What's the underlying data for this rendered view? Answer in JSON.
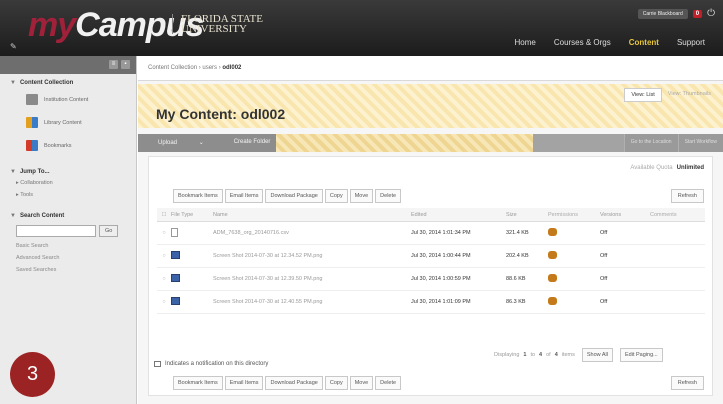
{
  "header": {
    "logo_my": "my",
    "logo_campus": "Campus",
    "university_line1": "FLORIDA STATE",
    "university_line2": "UNIVERSITY",
    "user_name": "Carrie Blackboard",
    "notification_count": "0",
    "nav": [
      "Home",
      "Courses & Orgs",
      "Content",
      "Support"
    ],
    "active_nav": "Content"
  },
  "sidebar": {
    "content_collection": "Content Collection",
    "collection_items": [
      "Institution Content",
      "Library Content",
      "Bookmarks"
    ],
    "jump_to": "Jump To...",
    "jump_items": [
      "Collaboration",
      "Tools"
    ],
    "search_content": "Search Content",
    "go_label": "Go",
    "search_links": [
      "Basic Search",
      "Advanced Search",
      "Saved Searches"
    ]
  },
  "step_badge": "3",
  "breadcrumb": {
    "root": "Content Collection",
    "users": "users",
    "current": "odl002"
  },
  "page": {
    "title": "My Content: odl002",
    "view_list": "View: List",
    "view_thumbnails": "View: Thumbnails"
  },
  "action_bar": {
    "upload": "Upload",
    "create_folder": "Create Folder",
    "go_to_location": "Go to the Location",
    "start_workflow": "Start Workflow"
  },
  "quota": {
    "label": "Available Quota",
    "value": "Unlimited"
  },
  "buttons": [
    "Bookmark Items",
    "Email Items",
    "Download Package",
    "Copy",
    "Move",
    "Delete"
  ],
  "refresh_label": "Refresh",
  "table": {
    "headers": [
      "File Type",
      "Name",
      "Edited",
      "Size",
      "Permissions",
      "Versions",
      "Comments"
    ],
    "rows": [
      {
        "type": "file",
        "name": "ADM_7638_org_20140716.csv",
        "edited": "Jul 30, 2014 1:01:34 PM",
        "size": "321.4 KB",
        "versions": "Off"
      },
      {
        "type": "image",
        "name": "Screen Shot 2014-07-30 at 12.34.52 PM.png",
        "edited": "Jul 30, 2014 1:00:44 PM",
        "size": "202.4 KB",
        "versions": "Off"
      },
      {
        "type": "image",
        "name": "Screen Shot 2014-07-30 at 12.39.50 PM.png",
        "edited": "Jul 30, 2014 1:00:59 PM",
        "size": "88.6 KB",
        "versions": "Off"
      },
      {
        "type": "image",
        "name": "Screen Shot 2014-07-30 at 12.40.55 PM.png",
        "edited": "Jul 30, 2014 1:01:09 PM",
        "size": "86.3 KB",
        "versions": "Off"
      }
    ]
  },
  "paging": {
    "text_before": "Displaying",
    "from": "1",
    "to_word": "to",
    "to": "4",
    "of_word": "of",
    "total": "4",
    "items_word": "items",
    "show_all": "Show All",
    "edit_paging": "Edit Paging..."
  },
  "notification_note": "Indicates a notification on this directory"
}
